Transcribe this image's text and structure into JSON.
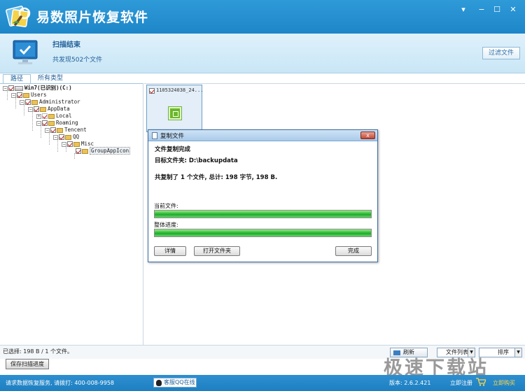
{
  "app": {
    "title": "易数照片恢复软件"
  },
  "window_controls": {
    "menu": "▾",
    "minimize": "−",
    "maximize": "☐",
    "close": "✕"
  },
  "banner": {
    "scan_title": "扫描结束",
    "found_text": "共发现502个文件",
    "filter_button": "过滤文件"
  },
  "tabs": [
    {
      "label": "路径",
      "active": true
    },
    {
      "label": "所有类型",
      "active": false
    }
  ],
  "tree": [
    {
      "label": "Win7(已识别)(C:)",
      "bold": true
    },
    {
      "label": "Users"
    },
    {
      "label": "Administrator"
    },
    {
      "label": "AppData"
    },
    {
      "label": "Local",
      "expander": "+"
    },
    {
      "label": "Roaming",
      "expander": "−"
    },
    {
      "label": "Tencent",
      "expander": "−"
    },
    {
      "label": "QQ",
      "expander": "−"
    },
    {
      "label": "Misc",
      "expander": "−"
    },
    {
      "label": "GroupAppIcon",
      "selected": true
    }
  ],
  "file_tile": {
    "name": "1105324038_24..."
  },
  "dialog": {
    "title": "复制文件",
    "close_glyph": "x",
    "heading": "文件复制完成",
    "target": "目标文件夹: D:\\backupdata",
    "summary": "共复制了 1 个文件, 总计: 198 字节, 198 B.",
    "current_file_label": "当前文件:",
    "overall_label": "整体进度:",
    "current_progress": 1.0,
    "overall_progress": 1.0,
    "buttons": {
      "details": "详情",
      "open_folder": "打开文件夹",
      "finish": "完成"
    },
    "accent": "#3b6ea5"
  },
  "status": {
    "selected": "已选择: 198 B / 1 个文件。",
    "refresh": "刷新",
    "view_select": "文件列表",
    "sort_select": "排序"
  },
  "save_progress_button": "保存扫描进度",
  "bottom": {
    "contact": "请求数据恢复服务, 请拨打: 400-008-9958",
    "qq_service": "客服QQ在线",
    "version": "版本: 2.6.2.421",
    "register": "立即注册",
    "buy_now": "立即购买"
  },
  "watermark": "极速下载站",
  "colors": {
    "titlebar": "#1d86c8",
    "progress_green": "#2fbf3a",
    "check_red": "#c0191a"
  }
}
